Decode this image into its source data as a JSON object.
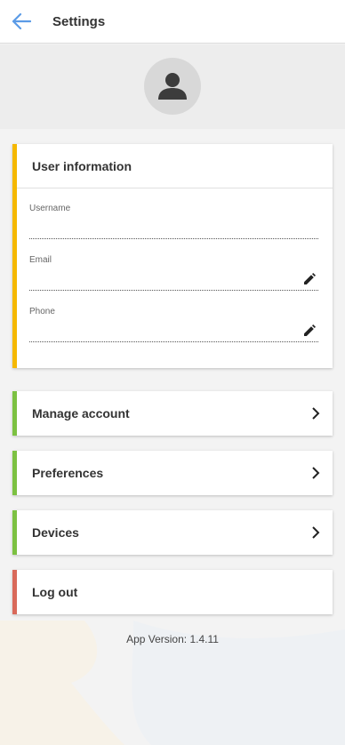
{
  "header": {
    "title": "Settings",
    "back_icon": "arrow-left-icon",
    "back_color": "#5b9be6"
  },
  "profile": {
    "avatar_icon": "person-icon"
  },
  "user_info": {
    "title": "User information",
    "accent_color": "#f5b800",
    "fields": [
      {
        "label": "Username",
        "value": "",
        "editable": false
      },
      {
        "label": "Email",
        "value": "",
        "editable": true,
        "edit_icon": "pencil-icon"
      },
      {
        "label": "Phone",
        "value": "",
        "editable": true,
        "edit_icon": "pencil-icon"
      }
    ]
  },
  "menu": [
    {
      "label": "Manage account",
      "accent_color": "#7cc142",
      "icon": "chevron-right-icon"
    },
    {
      "label": "Preferences",
      "accent_color": "#7cc142",
      "icon": "chevron-right-icon"
    },
    {
      "label": "Devices",
      "accent_color": "#7cc142",
      "icon": "chevron-right-icon"
    },
    {
      "label": "Log out",
      "accent_color": "#d9695a"
    }
  ],
  "footer": {
    "version_text": "App Version: 1.4.11"
  }
}
